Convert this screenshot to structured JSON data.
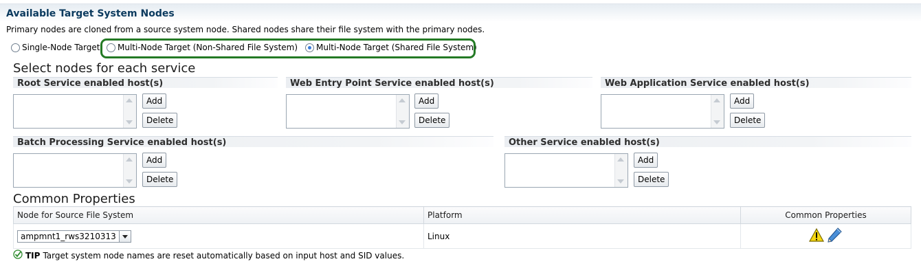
{
  "section": {
    "title": "Available Target System Nodes",
    "description": "Primary nodes are cloned from a source system node. Shared nodes share their file system with the primary nodes."
  },
  "target_options": [
    {
      "label": "Single-Node Target",
      "selected": false
    },
    {
      "label": "Multi-Node Target (Non-Shared File System)",
      "selected": false
    },
    {
      "label": "Multi-Node Target (Shared File System)",
      "selected": true
    }
  ],
  "highlight_color": "#247a25",
  "select_nodes_heading": "Select nodes for each service",
  "services": {
    "root": {
      "header": "Root Service enabled host(s)",
      "add": "Add",
      "delete": "Delete"
    },
    "web_entry": {
      "header": "Web Entry Point Service enabled host(s)",
      "add": "Add",
      "delete": "Delete"
    },
    "web_app": {
      "header": "Web Application Service enabled host(s)",
      "add": "Add",
      "delete": "Delete"
    },
    "batch": {
      "header": "Batch Processing Service enabled host(s)",
      "add": "Add",
      "delete": "Delete"
    },
    "other": {
      "header": "Other Service enabled host(s)",
      "add": "Add",
      "delete": "Delete"
    }
  },
  "common_properties": {
    "heading": "Common Properties",
    "columns": [
      "Node for Source File System",
      "Platform",
      "Common Properties"
    ],
    "row": {
      "node": "ampmnt1_rws3210313",
      "platform": "Linux",
      "warning_icon": "warning-icon",
      "edit_icon": "pencil-icon"
    }
  },
  "tip": {
    "label": "TIP",
    "text": "Target system node names are reset automatically based on input host and SID values."
  }
}
